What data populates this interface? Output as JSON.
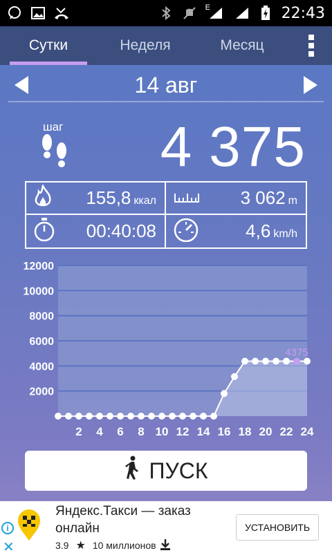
{
  "status_bar": {
    "time": "22:43",
    "network_label": "E"
  },
  "tabs": [
    {
      "label": "Сутки",
      "active": true
    },
    {
      "label": "Неделя",
      "active": false
    },
    {
      "label": "Месяц",
      "active": false
    }
  ],
  "date": "14 авг",
  "steps": {
    "label": "шаг",
    "value": "4 375"
  },
  "stats": {
    "calories": {
      "value": "155,8",
      "unit": "ккал"
    },
    "distance": {
      "value": "3 062",
      "unit": "m"
    },
    "duration": {
      "value": "00:40:08"
    },
    "speed": {
      "value": "4,6",
      "unit": "km/h"
    }
  },
  "chart_data": {
    "type": "line",
    "y_ticks": [
      "12000",
      "10000",
      "8000",
      "6000",
      "4000",
      "2000"
    ],
    "x_ticks": [
      "2",
      "4",
      "6",
      "8",
      "10",
      "12",
      "14",
      "16",
      "18",
      "20",
      "22",
      "24"
    ],
    "ylim": [
      0,
      12000
    ],
    "xlim": [
      0,
      24
    ],
    "x": [
      0,
      1,
      2,
      3,
      4,
      5,
      6,
      7,
      8,
      9,
      10,
      11,
      12,
      13,
      14,
      15,
      16,
      17,
      18,
      19,
      20,
      21,
      22,
      23,
      24
    ],
    "values": [
      0,
      0,
      0,
      0,
      0,
      0,
      0,
      0,
      0,
      0,
      0,
      0,
      0,
      0,
      0,
      0,
      1800,
      3150,
      4375,
      4375,
      4375,
      4375,
      4375,
      4375,
      4375
    ],
    "highlight": {
      "x": 23,
      "y": 4375,
      "label": "4375"
    },
    "colors": {
      "line": "#ffffff",
      "highlight": "#c89df0",
      "grid": "#5d74c4"
    }
  },
  "start_button": {
    "label": "ПУСК"
  },
  "ad": {
    "title": "Яндекс.Такси — заказ онлайн",
    "rating": "3.9",
    "installs": "10 миллионов",
    "install_label": "УСТАНОВИТЬ"
  }
}
